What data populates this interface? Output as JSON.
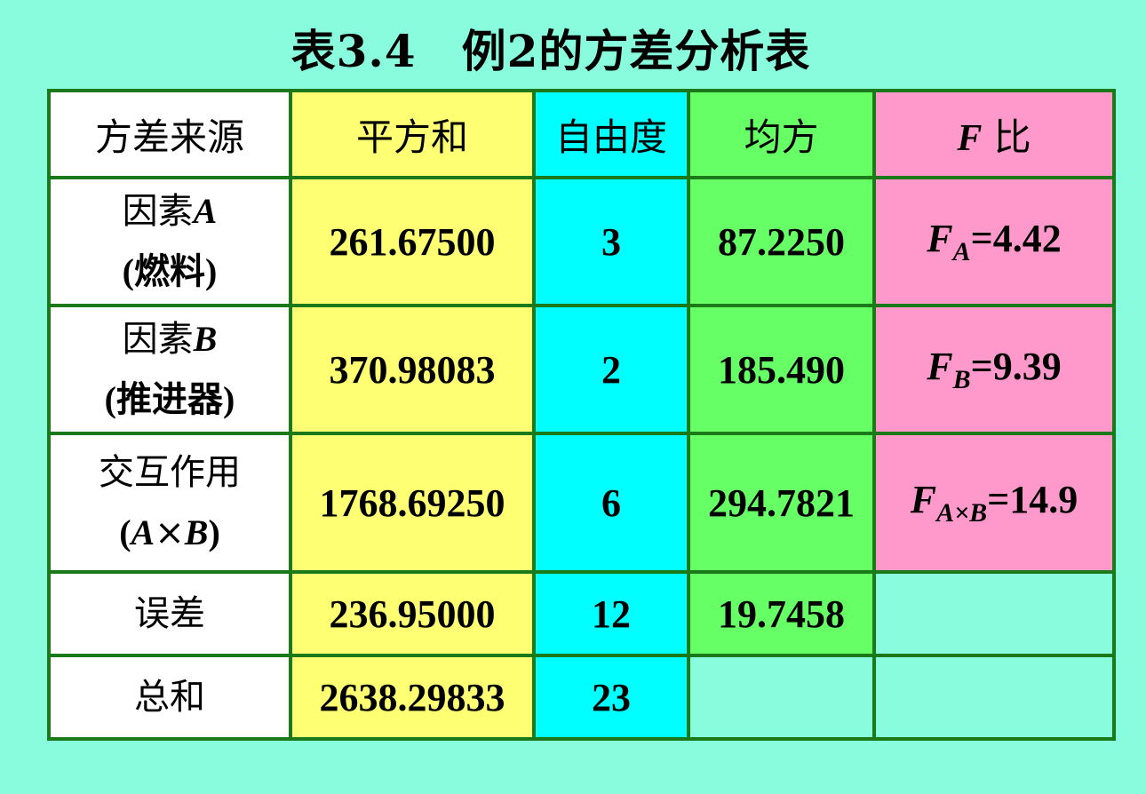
{
  "title": "表3.4　例2的方差分析表",
  "headers": {
    "source": "方差来源",
    "ss": "平方和",
    "df": "自由度",
    "ms": "均方",
    "f_letter": "F",
    "f_word": " 比"
  },
  "rows": [
    {
      "label_line1_cn": "因素",
      "label_line1_var": "A",
      "label_line2": "(燃料)",
      "ss": "261.67500",
      "df": "3",
      "ms": "87.2250",
      "f_letter": "F",
      "f_sub": "A",
      "f_rest": "=4.42"
    },
    {
      "label_line1_cn": "因素",
      "label_line1_var": "B",
      "label_line2": "(推进器)",
      "ss": "370.98083",
      "df": "2",
      "ms": "185.490",
      "f_letter": "F",
      "f_sub": "B",
      "f_rest": "=9.39"
    },
    {
      "label_line1": "交互作用",
      "label_line2_open": "(",
      "label_line2_a": "A",
      "label_line2_x": "×",
      "label_line2_b": "B",
      "label_line2_close": ")",
      "ss": "1768.69250",
      "df": "6",
      "ms": "294.7821",
      "f_letter": "F",
      "f_sub": "A×B",
      "f_rest": "=14.9"
    },
    {
      "label": "误差",
      "ss": "236.95000",
      "df": "12",
      "ms": "19.7458"
    },
    {
      "label": "总和",
      "ss": "2638.29833",
      "df": "23"
    }
  ]
}
